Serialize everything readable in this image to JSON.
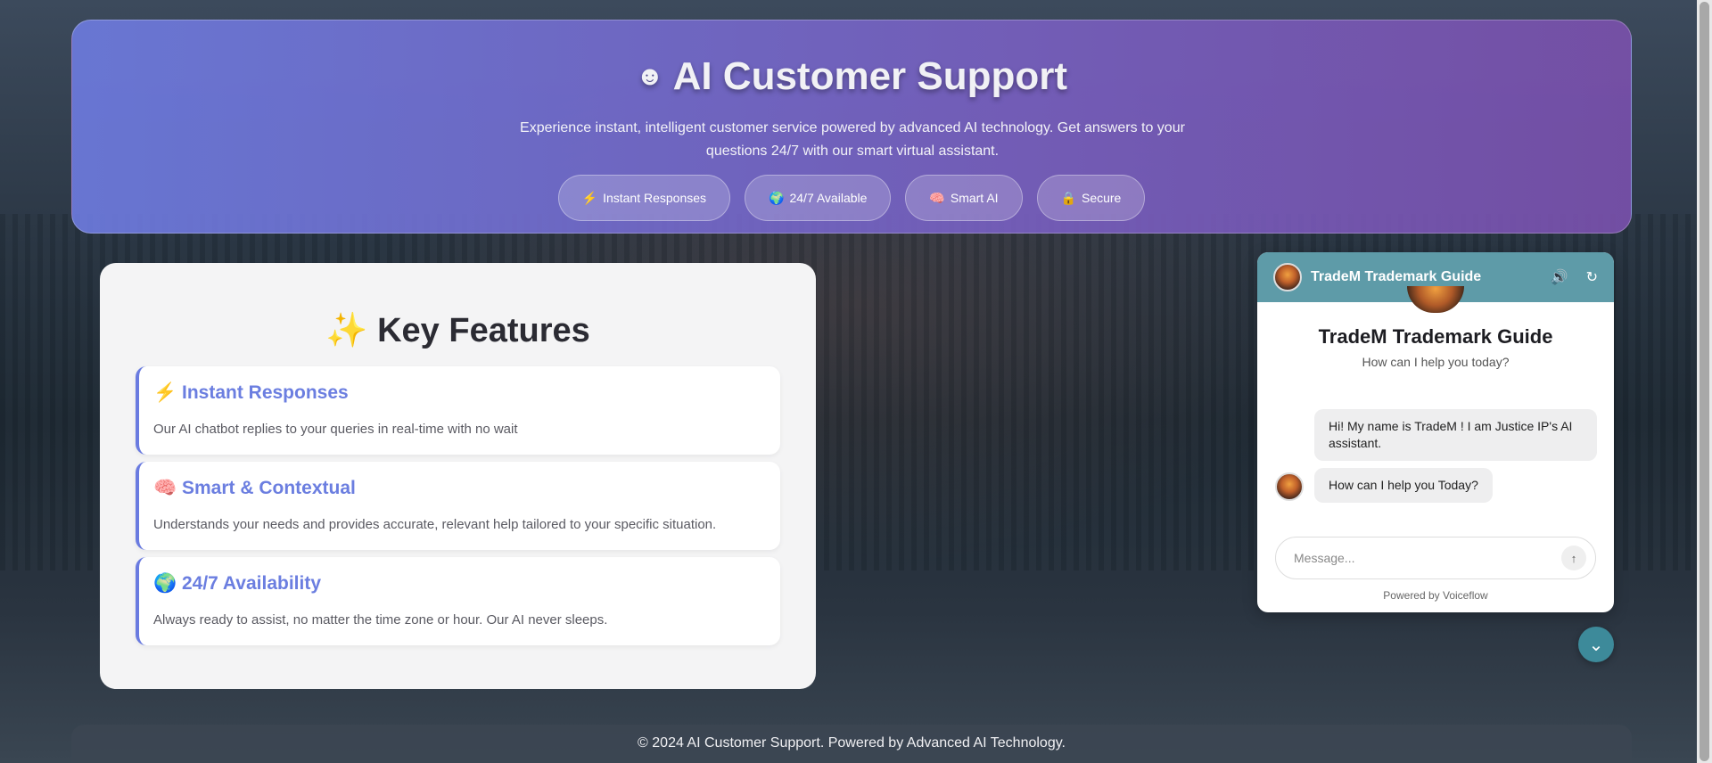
{
  "hero": {
    "icon": "robot-icon",
    "title": "AI Customer Support",
    "subtitle": "Experience instant, intelligent customer service powered by advanced AI technology. Get answers to your questions 24/7 with our smart virtual assistant.",
    "pills": [
      {
        "icon": "lightning-icon",
        "glyph": "⚡",
        "label": "Instant Responses"
      },
      {
        "icon": "globe-icon",
        "glyph": "🌍",
        "label": "24/7 Available"
      },
      {
        "icon": "brain-icon",
        "glyph": "🧠",
        "label": "Smart AI"
      },
      {
        "icon": "lock-icon",
        "glyph": "🔒",
        "label": "Secure"
      }
    ]
  },
  "features": {
    "title": "✨ Key Features",
    "items": [
      {
        "title": "⚡ Instant Responses",
        "desc": "Our AI chatbot replies to your queries in real-time with no wait"
      },
      {
        "title": "🧠 Smart & Contextual",
        "desc": "Understands your needs and provides accurate, relevant help tailored to your specific situation."
      },
      {
        "title": "🌍 24/7 Availability",
        "desc": "Always ready to assist, no matter the time zone or hour. Our AI never sleeps."
      }
    ]
  },
  "chat": {
    "header_name": "TradeM Trademark Guide",
    "title": "TradeM Trademark Guide",
    "subtitle": "How can I help you today?",
    "messages": [
      "Hi! My name is TradeM ! I am Justice IP's AI assistant.",
      "How can I help you Today?"
    ],
    "input_placeholder": "Message...",
    "powered_by": "Powered by Voiceflow",
    "colors": {
      "header": "#5e9ba8",
      "collapse_button": "#3d8a9a"
    }
  },
  "footer": {
    "text": "© 2024 AI Customer Support. Powered by Advanced AI Technology."
  }
}
